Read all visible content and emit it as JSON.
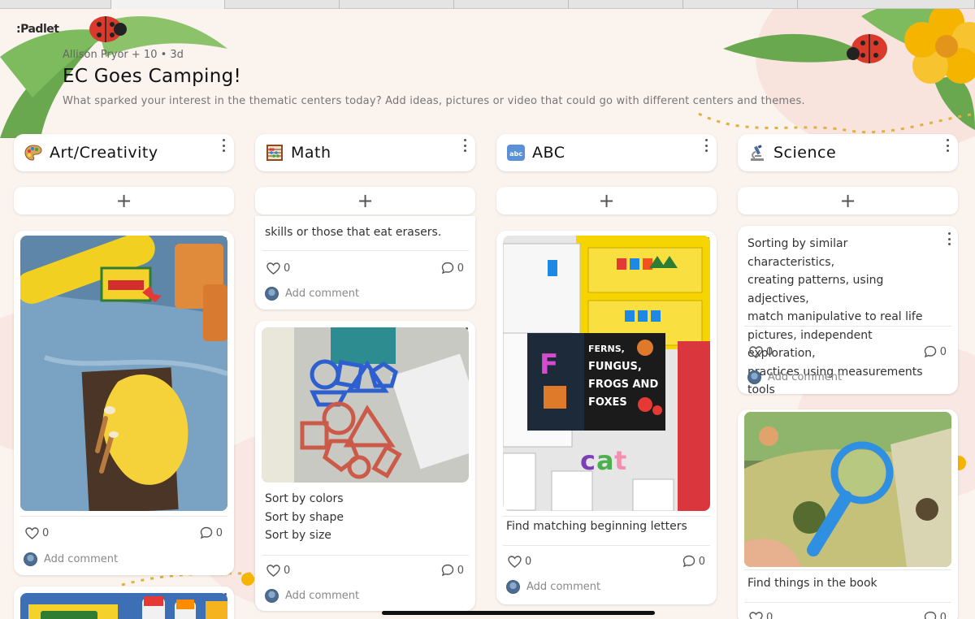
{
  "app": {
    "logo": ":Padlet"
  },
  "header": {
    "meta": "Allison Pryor + 10 • 3d",
    "title": "EC Goes Camping!",
    "description": "What sparked your interest in the thematic centers today? Add ideas, pictures or video that could go with different centers and themes."
  },
  "colors": {
    "accent": "#f4b400",
    "card_bg": "#ffffff",
    "page_bg": "#fbf3ee"
  },
  "columns": [
    {
      "title": "Art/Creativity",
      "icon": "palette-icon",
      "cards": [
        {
          "text": "",
          "likes": "0",
          "comments": "0",
          "add_comment": "Add comment",
          "image": "play-dough-photo"
        },
        {
          "text": "",
          "image": "crayola-supplies-photo"
        }
      ]
    },
    {
      "title": "Math",
      "icon": "abacus-icon",
      "cards": [
        {
          "text": "skills or those that eat erasers.",
          "likes": "0",
          "comments": "0",
          "add_comment": "Add comment"
        },
        {
          "text_lines": [
            "Sort by colors",
            "Sort by shape",
            "Sort by size"
          ],
          "likes": "0",
          "comments": "0",
          "add_comment": "Add comment",
          "image": "shape-sorting-photo"
        }
      ]
    },
    {
      "title": "ABC",
      "icon": "abc-input-icon",
      "cards": [
        {
          "text": "Find matching beginning letters",
          "likes": "0",
          "comments": "0",
          "add_comment": "Add comment",
          "image": "letter-matching-photo"
        }
      ]
    },
    {
      "title": "Science",
      "icon": "microscope-icon",
      "cards": [
        {
          "text_lines": [
            "Sorting by similar characteristics,",
            "creating patterns, using adjectives,",
            "match manipulative to real life",
            "pictures, independent exploration,",
            "practices using measurements tools"
          ],
          "likes": "0",
          "comments": "0",
          "add_comment": "Add comment"
        },
        {
          "text": "Find things in the book",
          "likes": "0",
          "comments": "0",
          "image": "magnifying-glass-book-photo"
        }
      ]
    }
  ]
}
